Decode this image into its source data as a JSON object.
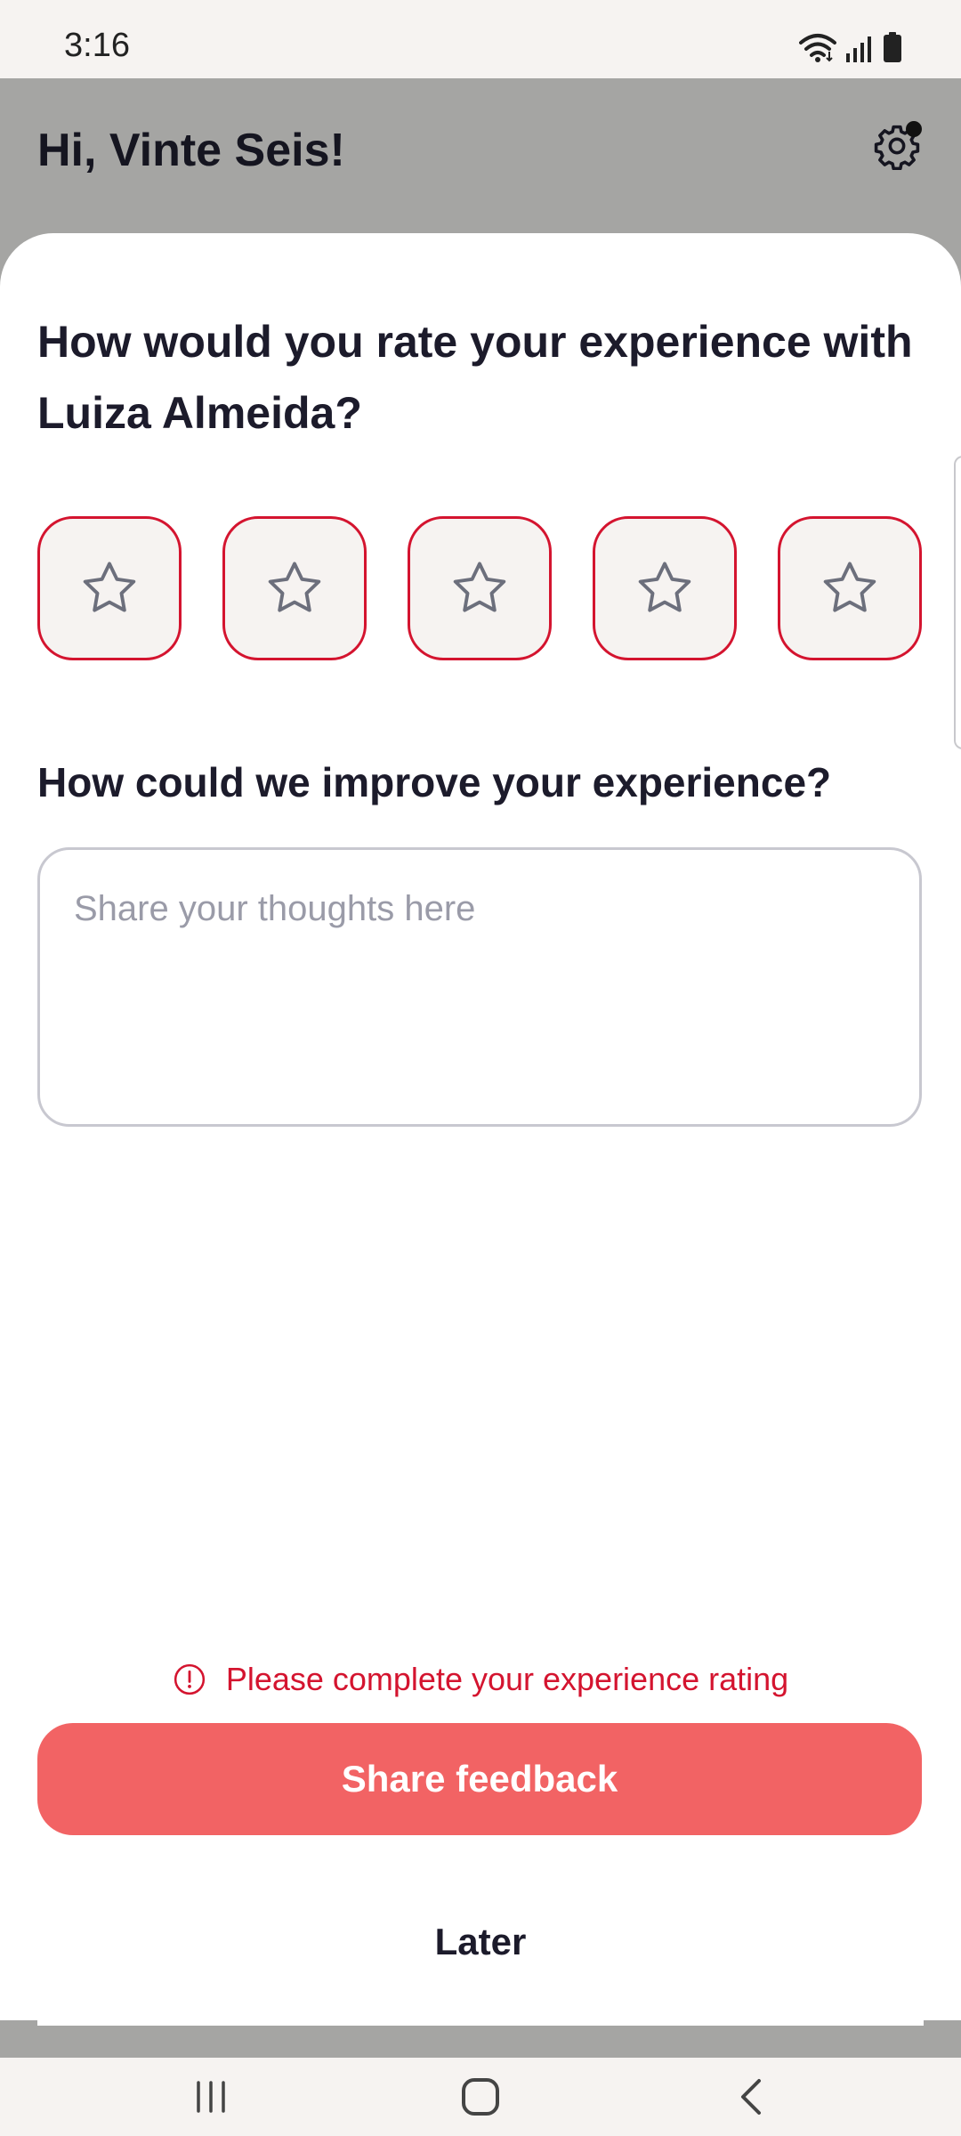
{
  "status_bar": {
    "time": "3:16"
  },
  "header": {
    "greeting": "Hi, Vinte Seis!"
  },
  "rating": {
    "question": "How would you rate your experience with Luiza Almeida?",
    "selected_stars": 0,
    "max_stars": 5
  },
  "feedback": {
    "label": "How could we improve your experience?",
    "placeholder": "Share your thoughts here",
    "value": ""
  },
  "validation": {
    "error": "Please complete your experience rating"
  },
  "actions": {
    "share_label": "Share feedback",
    "later_label": "Later"
  },
  "colors": {
    "accent": "#d4142f",
    "primary_button": "#f26364",
    "star_tile": "#f6f3f1",
    "scrim": "#a5a5a3"
  }
}
